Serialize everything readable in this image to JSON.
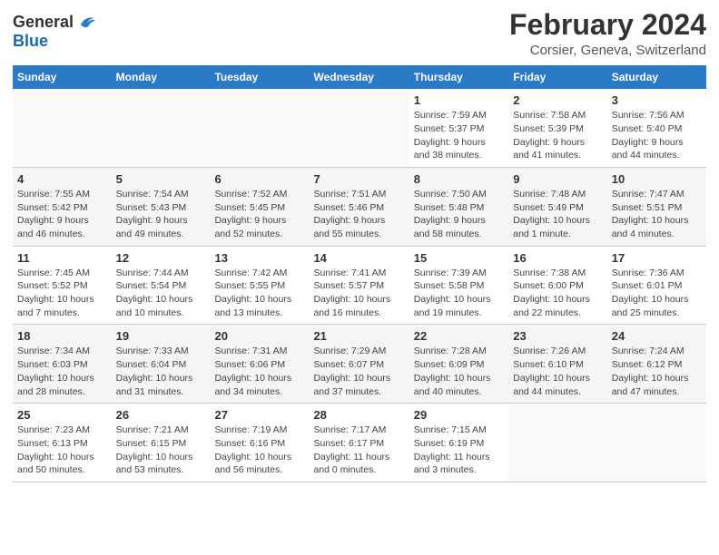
{
  "header": {
    "logo_general": "General",
    "logo_blue": "Blue",
    "month": "February 2024",
    "location": "Corsier, Geneva, Switzerland"
  },
  "days_of_week": [
    "Sunday",
    "Monday",
    "Tuesday",
    "Wednesday",
    "Thursday",
    "Friday",
    "Saturday"
  ],
  "weeks": [
    [
      {
        "day": "",
        "info": ""
      },
      {
        "day": "",
        "info": ""
      },
      {
        "day": "",
        "info": ""
      },
      {
        "day": "",
        "info": ""
      },
      {
        "day": "1",
        "info": "Sunrise: 7:59 AM\nSunset: 5:37 PM\nDaylight: 9 hours\nand 38 minutes."
      },
      {
        "day": "2",
        "info": "Sunrise: 7:58 AM\nSunset: 5:39 PM\nDaylight: 9 hours\nand 41 minutes."
      },
      {
        "day": "3",
        "info": "Sunrise: 7:56 AM\nSunset: 5:40 PM\nDaylight: 9 hours\nand 44 minutes."
      }
    ],
    [
      {
        "day": "4",
        "info": "Sunrise: 7:55 AM\nSunset: 5:42 PM\nDaylight: 9 hours\nand 46 minutes."
      },
      {
        "day": "5",
        "info": "Sunrise: 7:54 AM\nSunset: 5:43 PM\nDaylight: 9 hours\nand 49 minutes."
      },
      {
        "day": "6",
        "info": "Sunrise: 7:52 AM\nSunset: 5:45 PM\nDaylight: 9 hours\nand 52 minutes."
      },
      {
        "day": "7",
        "info": "Sunrise: 7:51 AM\nSunset: 5:46 PM\nDaylight: 9 hours\nand 55 minutes."
      },
      {
        "day": "8",
        "info": "Sunrise: 7:50 AM\nSunset: 5:48 PM\nDaylight: 9 hours\nand 58 minutes."
      },
      {
        "day": "9",
        "info": "Sunrise: 7:48 AM\nSunset: 5:49 PM\nDaylight: 10 hours\nand 1 minute."
      },
      {
        "day": "10",
        "info": "Sunrise: 7:47 AM\nSunset: 5:51 PM\nDaylight: 10 hours\nand 4 minutes."
      }
    ],
    [
      {
        "day": "11",
        "info": "Sunrise: 7:45 AM\nSunset: 5:52 PM\nDaylight: 10 hours\nand 7 minutes."
      },
      {
        "day": "12",
        "info": "Sunrise: 7:44 AM\nSunset: 5:54 PM\nDaylight: 10 hours\nand 10 minutes."
      },
      {
        "day": "13",
        "info": "Sunrise: 7:42 AM\nSunset: 5:55 PM\nDaylight: 10 hours\nand 13 minutes."
      },
      {
        "day": "14",
        "info": "Sunrise: 7:41 AM\nSunset: 5:57 PM\nDaylight: 10 hours\nand 16 minutes."
      },
      {
        "day": "15",
        "info": "Sunrise: 7:39 AM\nSunset: 5:58 PM\nDaylight: 10 hours\nand 19 minutes."
      },
      {
        "day": "16",
        "info": "Sunrise: 7:38 AM\nSunset: 6:00 PM\nDaylight: 10 hours\nand 22 minutes."
      },
      {
        "day": "17",
        "info": "Sunrise: 7:36 AM\nSunset: 6:01 PM\nDaylight: 10 hours\nand 25 minutes."
      }
    ],
    [
      {
        "day": "18",
        "info": "Sunrise: 7:34 AM\nSunset: 6:03 PM\nDaylight: 10 hours\nand 28 minutes."
      },
      {
        "day": "19",
        "info": "Sunrise: 7:33 AM\nSunset: 6:04 PM\nDaylight: 10 hours\nand 31 minutes."
      },
      {
        "day": "20",
        "info": "Sunrise: 7:31 AM\nSunset: 6:06 PM\nDaylight: 10 hours\nand 34 minutes."
      },
      {
        "day": "21",
        "info": "Sunrise: 7:29 AM\nSunset: 6:07 PM\nDaylight: 10 hours\nand 37 minutes."
      },
      {
        "day": "22",
        "info": "Sunrise: 7:28 AM\nSunset: 6:09 PM\nDaylight: 10 hours\nand 40 minutes."
      },
      {
        "day": "23",
        "info": "Sunrise: 7:26 AM\nSunset: 6:10 PM\nDaylight: 10 hours\nand 44 minutes."
      },
      {
        "day": "24",
        "info": "Sunrise: 7:24 AM\nSunset: 6:12 PM\nDaylight: 10 hours\nand 47 minutes."
      }
    ],
    [
      {
        "day": "25",
        "info": "Sunrise: 7:23 AM\nSunset: 6:13 PM\nDaylight: 10 hours\nand 50 minutes."
      },
      {
        "day": "26",
        "info": "Sunrise: 7:21 AM\nSunset: 6:15 PM\nDaylight: 10 hours\nand 53 minutes."
      },
      {
        "day": "27",
        "info": "Sunrise: 7:19 AM\nSunset: 6:16 PM\nDaylight: 10 hours\nand 56 minutes."
      },
      {
        "day": "28",
        "info": "Sunrise: 7:17 AM\nSunset: 6:17 PM\nDaylight: 11 hours\nand 0 minutes."
      },
      {
        "day": "29",
        "info": "Sunrise: 7:15 AM\nSunset: 6:19 PM\nDaylight: 11 hours\nand 3 minutes."
      },
      {
        "day": "",
        "info": ""
      },
      {
        "day": "",
        "info": ""
      }
    ]
  ]
}
